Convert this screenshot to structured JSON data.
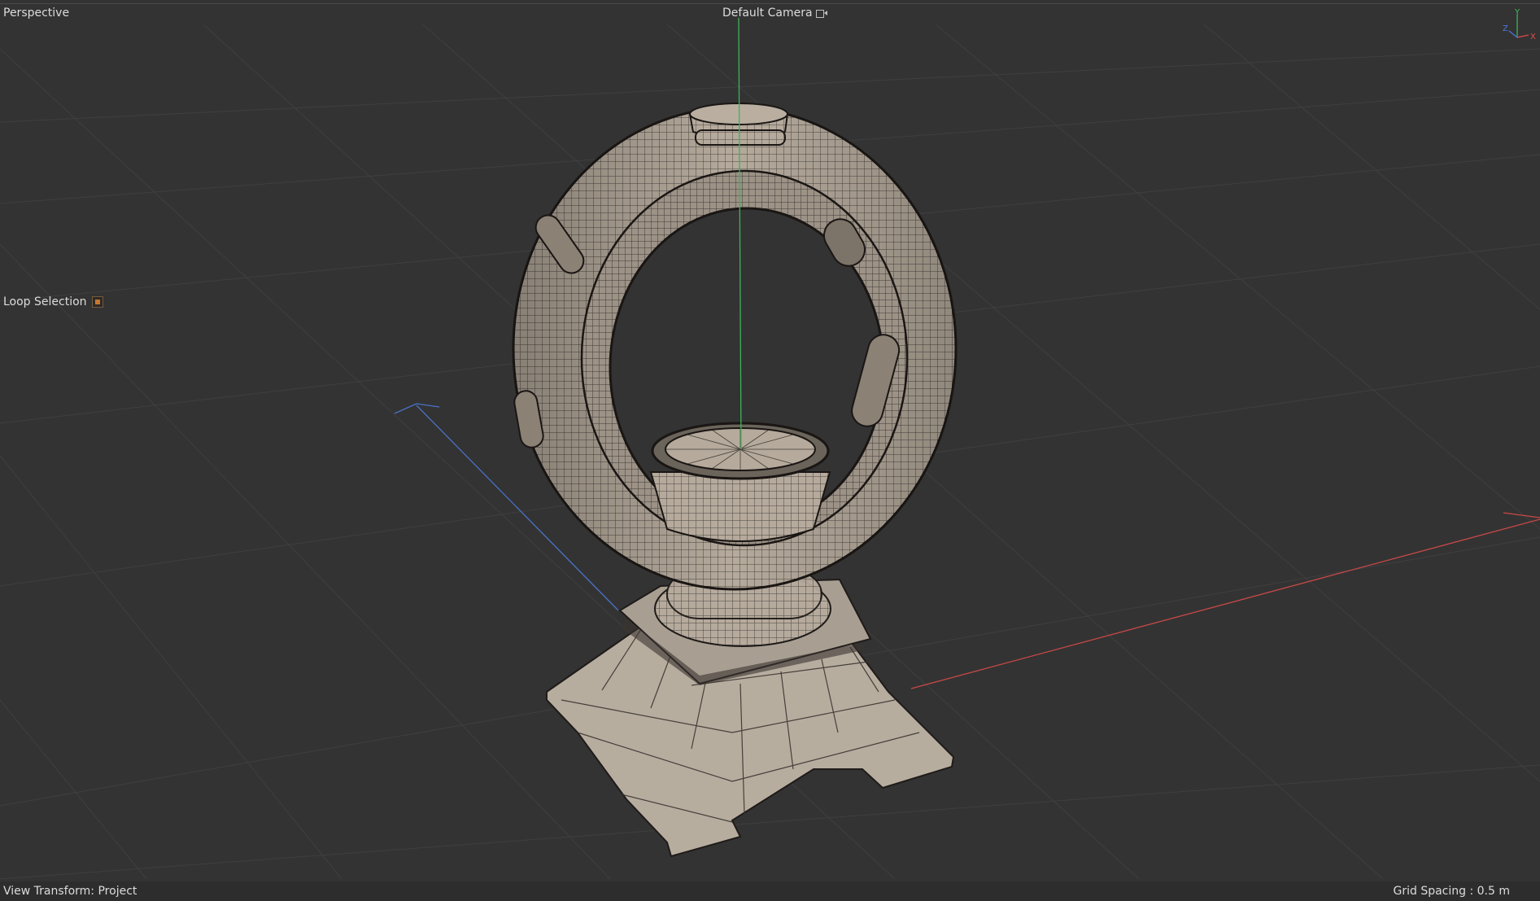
{
  "viewport": {
    "view_name": "Perspective",
    "camera_name": "Default Camera",
    "camera_icon": "camera-lock-icon",
    "tool_name": "Loop Selection",
    "view_transform": "View Transform: Project",
    "grid_spacing": "Grid Spacing : 0.5 m"
  },
  "axis_gizmo": {
    "y_label": "Y",
    "z_label": "Z",
    "x_label": "X",
    "colors": {
      "x": "#e04a4a",
      "y": "#3fc05a",
      "z": "#4a78e0"
    }
  },
  "colors": {
    "background": "#333333",
    "grid": "#3e3e3e",
    "model_fill": "#b8ad9f",
    "model_wire": "#2a2522",
    "axis_x": "#c94848",
    "axis_y": "#3fb35a",
    "axis_z": "#4a73c8"
  },
  "scene": {
    "object_icon": "trophy-ring-model"
  }
}
